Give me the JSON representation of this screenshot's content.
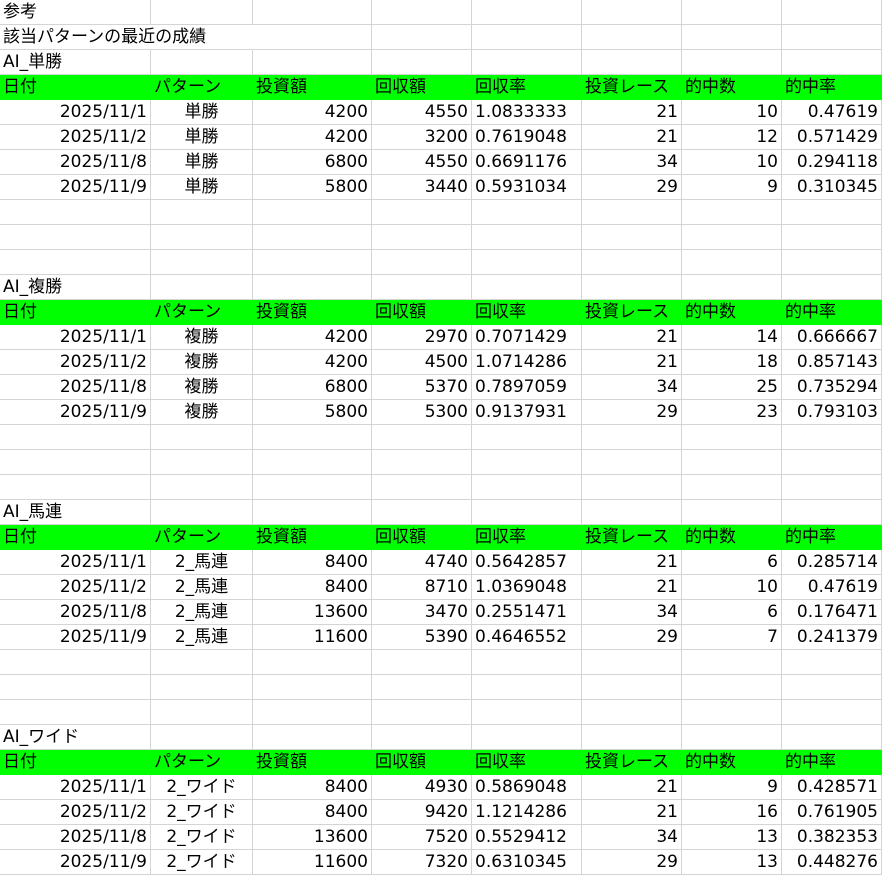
{
  "sheet": {
    "title": "参考",
    "subtitle": "該当パターンの最近の成績",
    "headers": [
      "日付",
      "パターン",
      "投資額",
      "回収額",
      "回収率",
      "投資レース",
      "的中数",
      "的中率"
    ],
    "sections": [
      {
        "name": "AI_単勝",
        "rows": [
          [
            "2025/11/1",
            "単勝",
            "4200",
            "4550",
            "1.0833333",
            "21",
            "10",
            "0.47619"
          ],
          [
            "2025/11/2",
            "単勝",
            "4200",
            "3200",
            "0.7619048",
            "21",
            "12",
            "0.571429"
          ],
          [
            "2025/11/8",
            "単勝",
            "6800",
            "4550",
            "0.6691176",
            "34",
            "10",
            "0.294118"
          ],
          [
            "2025/11/9",
            "単勝",
            "5800",
            "3440",
            "0.5931034",
            "29",
            "9",
            "0.310345"
          ]
        ]
      },
      {
        "name": "AI_複勝",
        "rows": [
          [
            "2025/11/1",
            "複勝",
            "4200",
            "2970",
            "0.7071429",
            "21",
            "14",
            "0.666667"
          ],
          [
            "2025/11/2",
            "複勝",
            "4200",
            "4500",
            "1.0714286",
            "21",
            "18",
            "0.857143"
          ],
          [
            "2025/11/8",
            "複勝",
            "6800",
            "5370",
            "0.7897059",
            "34",
            "25",
            "0.735294"
          ],
          [
            "2025/11/9",
            "複勝",
            "5800",
            "5300",
            "0.9137931",
            "29",
            "23",
            "0.793103"
          ]
        ]
      },
      {
        "name": "AI_馬連",
        "rows": [
          [
            "2025/11/1",
            "2_馬連",
            "8400",
            "4740",
            "0.5642857",
            "21",
            "6",
            "0.285714"
          ],
          [
            "2025/11/2",
            "2_馬連",
            "8400",
            "8710",
            "1.0369048",
            "21",
            "10",
            "0.47619"
          ],
          [
            "2025/11/8",
            "2_馬連",
            "13600",
            "3470",
            "0.2551471",
            "34",
            "6",
            "0.176471"
          ],
          [
            "2025/11/9",
            "2_馬連",
            "11600",
            "5390",
            "0.4646552",
            "29",
            "7",
            "0.241379"
          ]
        ]
      },
      {
        "name": "AI_ワイド",
        "rows": [
          [
            "2025/11/1",
            "2_ワイド",
            "8400",
            "4930",
            "0.5869048",
            "21",
            "9",
            "0.428571"
          ],
          [
            "2025/11/2",
            "2_ワイド",
            "8400",
            "9420",
            "1.1214286",
            "21",
            "16",
            "0.761905"
          ],
          [
            "2025/11/8",
            "2_ワイド",
            "13600",
            "7520",
            "0.5529412",
            "34",
            "13",
            "0.382353"
          ],
          [
            "2025/11/9",
            "2_ワイド",
            "11600",
            "7320",
            "0.6310345",
            "29",
            "13",
            "0.448276"
          ]
        ]
      }
    ]
  }
}
